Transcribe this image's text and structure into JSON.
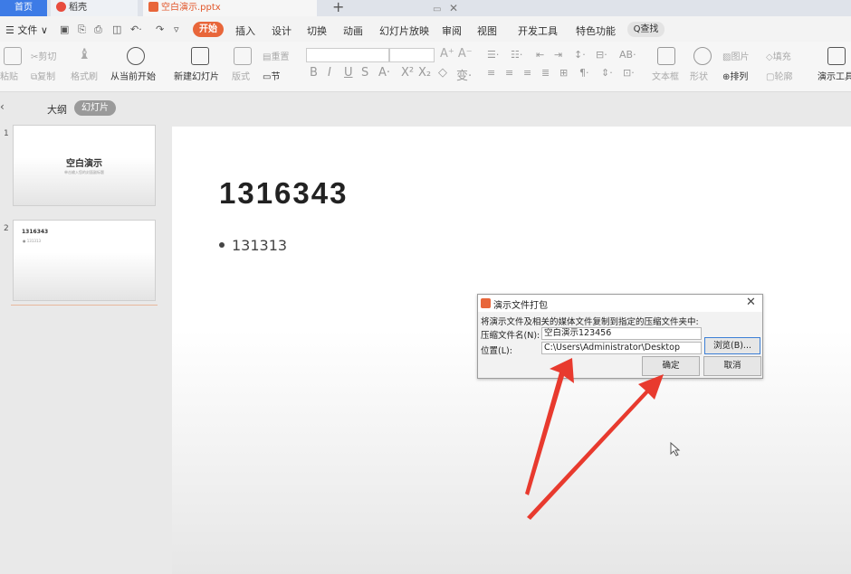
{
  "tabs": {
    "home": "首页",
    "docer": "稻壳",
    "doc": "空白演示.pptx",
    "add": "+",
    "close": "✕"
  },
  "menu": {
    "file": "☰ 文件 ∨",
    "items": [
      "开始",
      "插入",
      "设计",
      "切换",
      "动画",
      "幻灯片放映",
      "审阅",
      "视图",
      "开发工具",
      "特色功能"
    ],
    "search": "Q查找"
  },
  "ribbon": {
    "paste": "粘贴",
    "cut": "剪切",
    "copy": "复制",
    "format_painter": "格式刷",
    "from_current": "从当前开始",
    "new_slide": "新建幻灯片",
    "layout": "版式",
    "reset": "重置",
    "section": "节",
    "textbox": "文本框",
    "shape": "形状",
    "picture": "图片",
    "fill": "填充",
    "arrange": "排列",
    "outline": "轮廓",
    "present_tools": "演示工具"
  },
  "left_panel": {
    "view_outline": "大纲",
    "view_slides": "幻灯片",
    "slides": [
      {
        "num": "1",
        "title": "空白演示",
        "subtitle": "单击输入您的封面副标题"
      },
      {
        "num": "2",
        "title": "1316343",
        "bullet": "● 131313"
      }
    ]
  },
  "slide": {
    "title": "1316343",
    "bullet": "131313"
  },
  "dialog": {
    "title": "演示文件打包",
    "close": "✕",
    "description": "将演示文件及相关的媒体文件复制到指定的压缩文件夹中:",
    "filename_label": "压缩文件名(N):",
    "filename_value": "空白演示123456",
    "location_label": "位置(L):",
    "location_value": "C:\\Users\\Administrator\\Desktop",
    "browse": "浏览(B)...",
    "ok": "确定",
    "cancel": "取消"
  },
  "colors": {
    "accent": "#e8663a",
    "home_tab": "#3d7be6",
    "arrow": "#e83a2e"
  }
}
